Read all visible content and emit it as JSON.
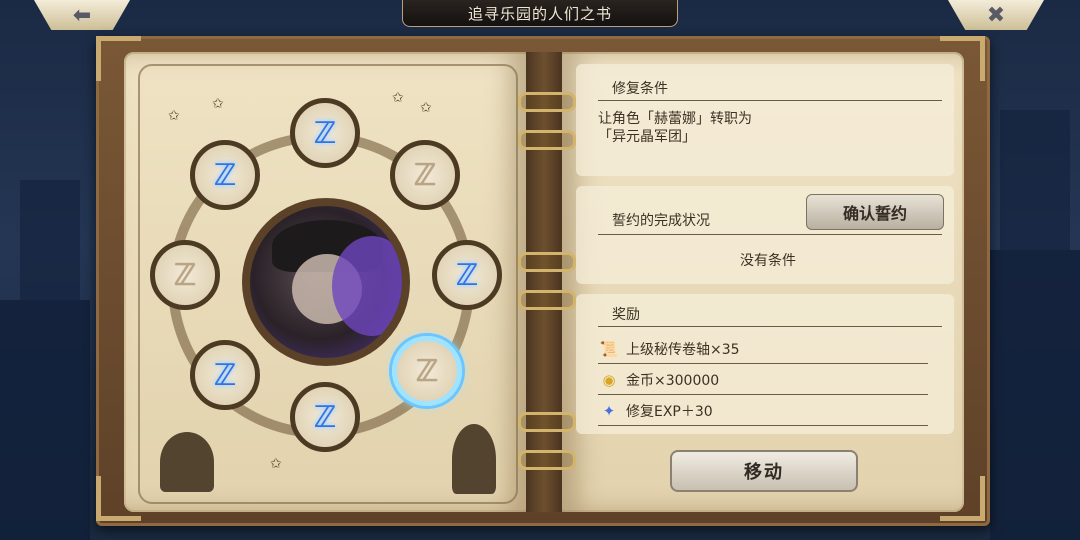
{
  "header": {
    "title": "追寻乐园的人们之书",
    "back_icon": "arrow-left-icon",
    "close_icon": "close-icon",
    "back_glyph": "⬅",
    "close_glyph": "✖"
  },
  "repair_conditions": {
    "label": "修复条件",
    "line1": "让角色「赫蕾娜」转职为",
    "line2": "「异元晶军团」"
  },
  "pledge": {
    "label": "誓约的完成状况",
    "confirm_button": "确认誓约",
    "status": "没有条件"
  },
  "rewards": {
    "label": "奖励",
    "items": [
      {
        "icon": "scroll-icon",
        "glyph": "📜",
        "text": "上级秘传卷轴×35"
      },
      {
        "icon": "gold-coin-icon",
        "glyph": "◉",
        "text": "金币×300000"
      },
      {
        "icon": "repair-exp-icon",
        "glyph": "✦",
        "text": "修复EXP＋30"
      }
    ]
  },
  "move_button": "移动",
  "rune_nodes": [
    {
      "name": "rune-node-top",
      "glyph": "ℤ",
      "state": "lit"
    },
    {
      "name": "rune-node-top-right",
      "glyph": "ℤ",
      "state": "dim"
    },
    {
      "name": "rune-node-right",
      "glyph": "ℤ",
      "state": "lit"
    },
    {
      "name": "rune-node-bottom-right",
      "glyph": "ℤ",
      "state": "dim-selected"
    },
    {
      "name": "rune-node-bottom",
      "glyph": "ℤ",
      "state": "lit"
    },
    {
      "name": "rune-node-bottom-left",
      "glyph": "ℤ",
      "state": "lit"
    },
    {
      "name": "rune-node-left",
      "glyph": "ℤ",
      "state": "dim"
    },
    {
      "name": "rune-node-top-left",
      "glyph": "ℤ",
      "state": "lit"
    }
  ],
  "colors": {
    "rune_lit": "#2f74e6",
    "rune_dim": "#b9a485",
    "page": "#efe3c4",
    "book_cover": "#6e5030"
  }
}
